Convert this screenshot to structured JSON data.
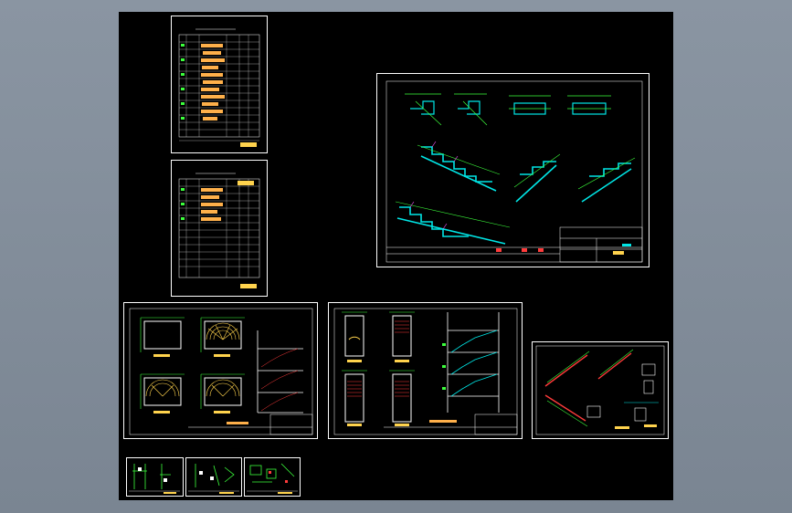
{
  "app": {
    "name": "",
    "background": "#7f8a97",
    "canvas_color": "#000000"
  },
  "sheets": [
    {
      "id": "sheet-table-1",
      "kind": "table",
      "title_cjk": "楼梯配筋表"
    },
    {
      "id": "sheet-table-2",
      "kind": "table",
      "title_cjk": "楼梯配筋表"
    },
    {
      "id": "sheet-sections",
      "kind": "drawing"
    },
    {
      "id": "sheet-spiral-plans",
      "kind": "drawing"
    },
    {
      "id": "sheet-straight-plans",
      "kind": "drawing"
    },
    {
      "id": "sheet-details",
      "kind": "drawing"
    },
    {
      "id": "sheet-small-1",
      "kind": "drawing"
    },
    {
      "id": "sheet-small-2",
      "kind": "drawing"
    },
    {
      "id": "sheet-small-3",
      "kind": "drawing"
    }
  ],
  "colors": {
    "frame": "#ffffff",
    "green": "#3cff3c",
    "cyan": "#00e6e6",
    "yellow": "#ffd34d",
    "orange": "#ffb04a",
    "red": "#ff3b3b",
    "magenta": "#ff55ff"
  }
}
